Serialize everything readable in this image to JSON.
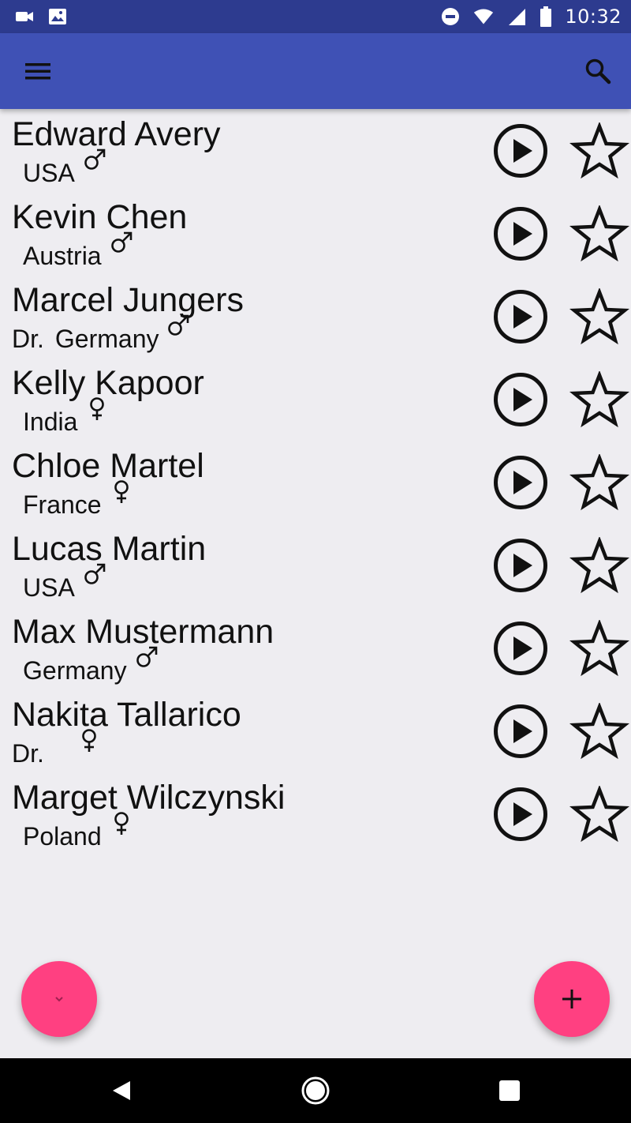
{
  "status_bar": {
    "time": "10:32",
    "left_icons": [
      "video-camera-icon",
      "image-icon"
    ],
    "right_icons": [
      "do-not-disturb-icon",
      "wifi-icon",
      "signal-icon",
      "battery-icon"
    ]
  },
  "app_bar": {
    "menu_icon": "menu-icon",
    "search_icon": "search-icon",
    "color": "#3f51b5"
  },
  "people": [
    {
      "name": "Edward Avery",
      "title": "",
      "country": "USA",
      "gender": "male"
    },
    {
      "name": "Kevin Chen",
      "title": "",
      "country": "Austria",
      "gender": "male"
    },
    {
      "name": "Marcel Jungers",
      "title": "Dr.",
      "country": "Germany",
      "gender": "male"
    },
    {
      "name": "Kelly Kapoor",
      "title": "",
      "country": "India",
      "gender": "female"
    },
    {
      "name": "Chloe Martel",
      "title": "",
      "country": "France",
      "gender": "female"
    },
    {
      "name": "Lucas Martin",
      "title": "",
      "country": "USA",
      "gender": "male"
    },
    {
      "name": "Max Mustermann",
      "title": "",
      "country": "Germany",
      "gender": "male"
    },
    {
      "name": "Nakita Tallarico",
      "title": "Dr.",
      "country": "",
      "gender": "female"
    },
    {
      "name": "Marget Wilczynski",
      "title": "",
      "country": "Poland",
      "gender": "female"
    }
  ],
  "row_actions": {
    "play_icon": "play-circle-icon",
    "favorite_icon": "star-outline-icon"
  },
  "fabs": {
    "left_icon": "chevron-down-icon",
    "right_icon": "plus-icon",
    "color": "#ff4081"
  },
  "nav_bar": {
    "icons": [
      "back-icon",
      "home-icon",
      "recents-icon"
    ]
  }
}
